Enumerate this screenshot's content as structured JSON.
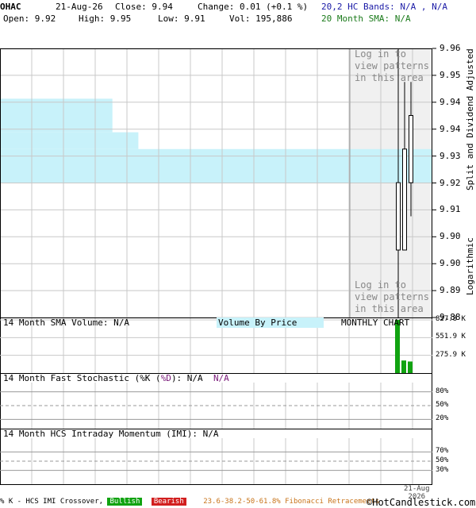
{
  "header": {
    "symbol": "OHAC",
    "date": "21-Aug-26",
    "close": "Close: 9.94",
    "change": "Change: 0.01 (+0.1 %)",
    "open": "Open: 9.92",
    "high": "High: 9.95",
    "low": "Low: 9.91",
    "volume": "Vol: 195,886",
    "hc_bands": "20,2 HC Bands: N/A , N/A",
    "sma20": "20 Month SMA: N/A"
  },
  "price_panel": {
    "right_axis_title": "Split and Dividend Adjusted",
    "log_label": "Logarithmic",
    "pattern_note_top": "Log in to\nview patterns\nin this area",
    "pattern_note_bottom": "Log in to\nview patterns\nin this area",
    "volume_by_price_label": "Volume By Price",
    "chart_period_label": "MONTHLY CHART"
  },
  "volume_panel": {
    "label": "14 Month SMA Volume: N/A",
    "ticks": [
      "827.8 K",
      "551.9 K",
      "275.9 K"
    ]
  },
  "stoch_panel": {
    "label_prefix": "14 Month Fast Stochastic (",
    "k": "%K",
    "d": "%D",
    "label_suffix": "): N/A",
    "d_value": "N/A",
    "ticks": [
      "80%",
      "50%",
      "20%"
    ]
  },
  "imi_panel": {
    "label": "14 Month HCS Intraday Momentum (IMI): N/A",
    "ticks": [
      "70%",
      "50%",
      "30%"
    ]
  },
  "x_axis": {
    "date_line1": "21-Aug",
    "date_line2": "2026"
  },
  "footer": {
    "crossover": "% K - HCS IMI Crossover,",
    "bullish": "Bullish",
    "bearish": "Bearish",
    "fib": "23.6-38.2-50-61.8% Fibonacci Retracements",
    "logo": "©HotCandlestick.com"
  },
  "colors": {
    "vbp_fill": "#c8f2fa",
    "candle": "#000000",
    "volume_bar": "#11a311",
    "pattern_shade": "#f0f0f0",
    "grid": "#c8c8c8"
  },
  "chart_data": {
    "type": "candlestick",
    "y_scale": "log",
    "ylim": [
      9.88,
      9.96
    ],
    "y_tick_labels": [
      "9.96",
      "9.95",
      "9.94",
      "9.94",
      "9.93",
      "9.92",
      "9.91",
      "9.90",
      "9.90",
      "9.89",
      "9.88"
    ],
    "candles": [
      {
        "open": 9.9,
        "high": 9.96,
        "low": 9.88,
        "close": 9.92
      },
      {
        "open": 9.9,
        "high": 9.95,
        "low": 9.9,
        "close": 9.93
      },
      {
        "open": 9.92,
        "high": 9.95,
        "low": 9.91,
        "close": 9.94
      }
    ],
    "volume_by_price": [
      {
        "price_low": 9.935,
        "price_high": 9.945,
        "relative": 0.26
      },
      {
        "price_low": 9.93,
        "price_high": 9.935,
        "relative": 0.32
      },
      {
        "price_low": 9.92,
        "price_high": 9.93,
        "relative": 1.0
      }
    ],
    "volume": {
      "ylim": [
        0,
        827.8
      ],
      "unit": "K",
      "values": [
        827.8,
        195.9,
        180.0
      ]
    }
  }
}
